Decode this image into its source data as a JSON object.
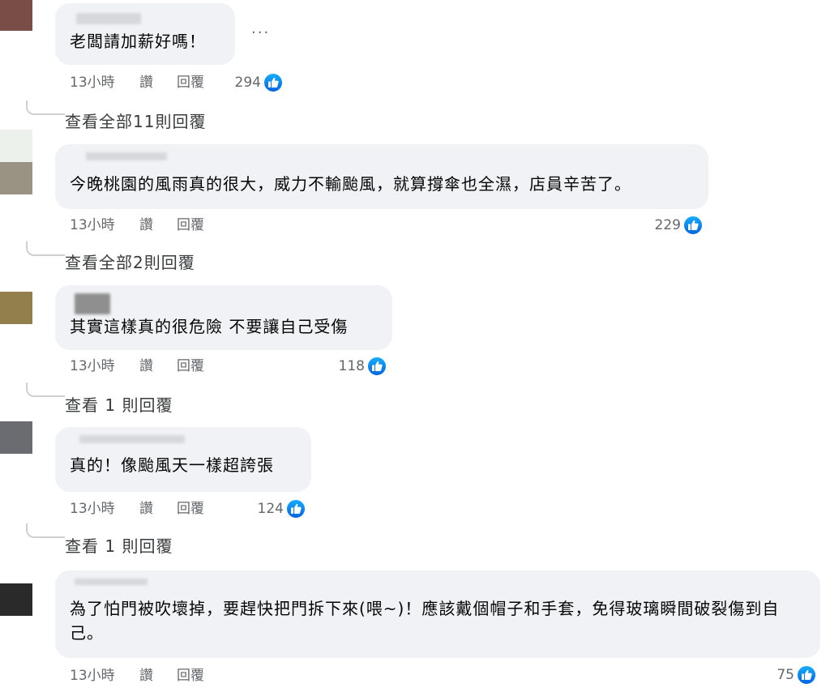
{
  "comments": [
    {
      "text": "老闆請加薪好嗎！",
      "time": "13小時",
      "like_action": "讚",
      "reply_action": "回覆",
      "likes": "294",
      "view_replies": "查看全部11則回覆",
      "avatar_color": "#7a4d47"
    },
    {
      "text": "今晚桃園的風雨真的很大，威力不輸颱風，就算撐傘也全濕，店員辛苦了。",
      "time": "13小時",
      "like_action": "讚",
      "reply_action": "回覆",
      "likes": "229",
      "view_replies": "查看全部2則回覆",
      "avatar_color": "#9a9384"
    },
    {
      "text": "其實這樣真的很危險 不要讓自己受傷",
      "time": "13小時",
      "like_action": "讚",
      "reply_action": "回覆",
      "likes": "118",
      "view_replies": "查看 1 則回覆",
      "avatar_color": "#927f4c"
    },
    {
      "text": "真的！像颱風天一樣超誇張",
      "time": "13小時",
      "like_action": "讚",
      "reply_action": "回覆",
      "likes": "124",
      "view_replies": "查看 1 則回覆",
      "avatar_color": "#6a6c72"
    },
    {
      "text": "為了怕門被吹壞掉，要趕快把門拆下來(喂~)！應該戴個帽子和手套，免得玻璃瞬間破裂傷到自己。",
      "time": "13小時",
      "like_action": "讚",
      "reply_action": "回覆",
      "likes": "75",
      "avatar_color": "#2a2a2a"
    }
  ],
  "more_options": "···",
  "colors": {
    "like_blue": "#1877f2",
    "bubble": "#f0f2f5",
    "meta_text": "#65676b"
  }
}
